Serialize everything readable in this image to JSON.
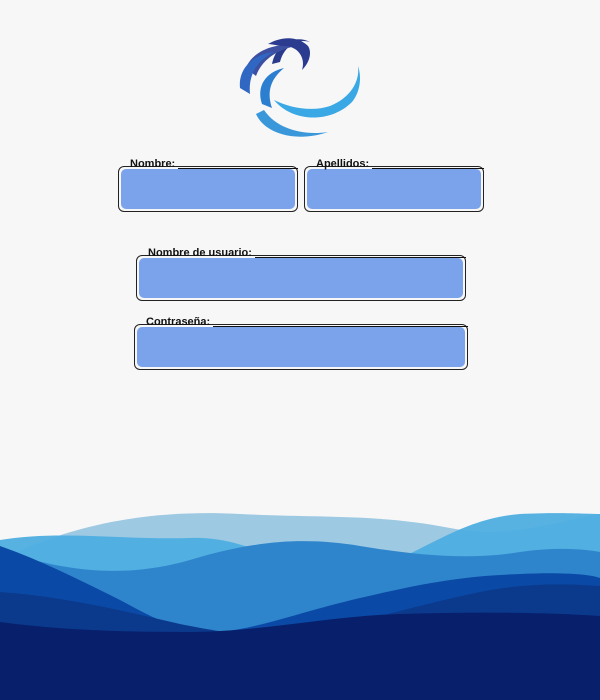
{
  "brand": {
    "logo_icon": "swirl-logo-icon",
    "colors": [
      "#2a3a8c",
      "#2f67c2",
      "#3aa0dd",
      "#4fb6ea"
    ]
  },
  "form": {
    "fields": [
      {
        "label": "Nombre:",
        "value": "",
        "placeholder": ""
      },
      {
        "label": "Apellidos:",
        "value": "",
        "placeholder": ""
      },
      {
        "label": "Nombre de usuario:",
        "value": "",
        "placeholder": ""
      },
      {
        "label": "Contraseña:",
        "value": "",
        "placeholder": ""
      }
    ],
    "field_fill_color": "#7aa3ec"
  },
  "footer": {
    "wave_colors": [
      "#9dc9e3",
      "#4eaee0",
      "#2f85cc",
      "#0a4aa6",
      "#0b3a8d",
      "#081f6b"
    ]
  }
}
